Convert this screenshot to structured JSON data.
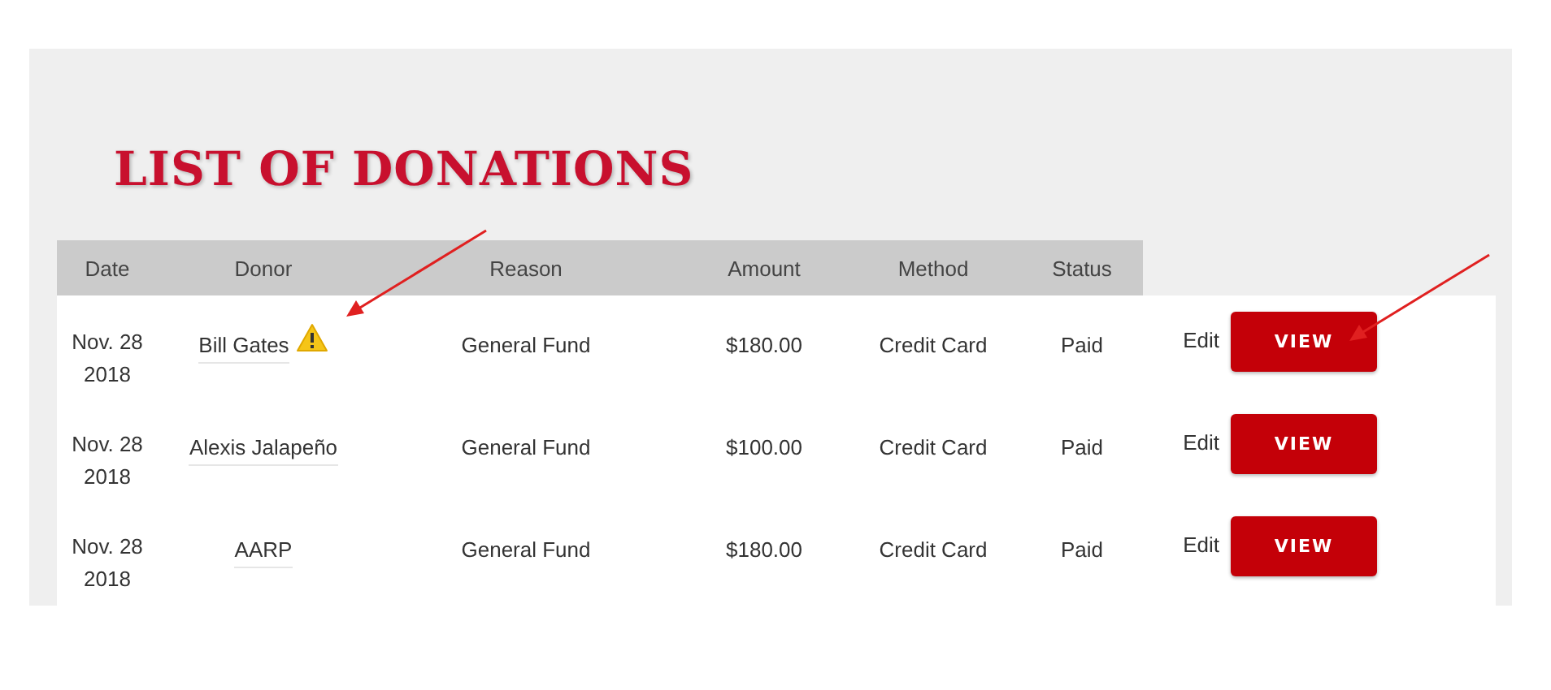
{
  "title": "LIST OF DONATIONS",
  "columns": [
    "Date",
    "Donor",
    "Reason",
    "Amount",
    "Method",
    "Status"
  ],
  "rows": [
    {
      "date": "Nov. 28",
      "year": "2018",
      "donor": "Bill Gates",
      "warning": true,
      "reason": "General Fund",
      "amount": "$180.00",
      "method": "Credit Card",
      "status": "Paid",
      "edit": "Edit",
      "view": "VIEW"
    },
    {
      "date": "Nov. 28",
      "year": "2018",
      "donor": "Alexis Jalapeño",
      "warning": false,
      "reason": "General Fund",
      "amount": "$100.00",
      "method": "Credit Card",
      "status": "Paid",
      "edit": "Edit",
      "view": "VIEW"
    },
    {
      "date": "Nov. 28",
      "year": "2018",
      "donor": "AARP",
      "warning": false,
      "reason": "General Fund",
      "amount": "$180.00",
      "method": "Credit Card",
      "status": "Paid",
      "edit": "Edit",
      "view": "VIEW"
    }
  ]
}
